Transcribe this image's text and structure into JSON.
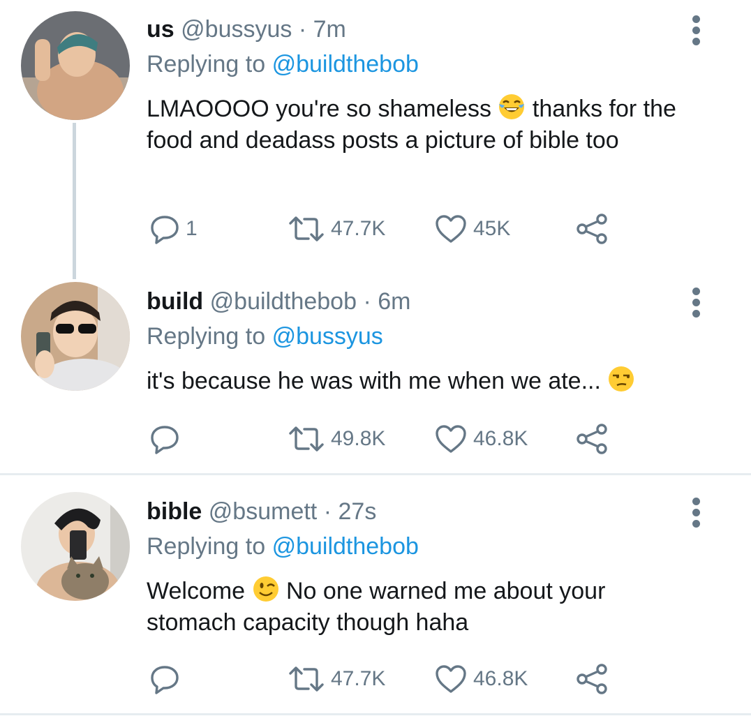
{
  "tweets": [
    {
      "name": "us",
      "handle": "@bussyus",
      "dot": "·",
      "time": "7m",
      "replying_prefix": "Replying to",
      "replying_to": "@buildthebob",
      "text_before": "LMAOOOO you're so shameless",
      "emoji": "face-with-tears-of-joy",
      "text_after": "thanks for the food and deadass posts a picture of bible too",
      "replies": "1",
      "retweets": "47.7K",
      "likes": "45K"
    },
    {
      "name": "build",
      "handle": "@buildthebob",
      "dot": "·",
      "time": "6m",
      "replying_prefix": "Replying to",
      "replying_to": "@bussyus",
      "text_before": "it's because he was with me when we ate...",
      "emoji": "unamused-face",
      "text_after": "",
      "replies": "",
      "retweets": "49.8K",
      "likes": "46.8K"
    },
    {
      "name": "bible",
      "handle": "@bsumett",
      "dot": "·",
      "time": "27s",
      "replying_prefix": "Replying to",
      "replying_to": "@buildthebob",
      "text_before": "Welcome",
      "emoji": "winking-face",
      "text_after": "No one warned me about your stomach capacity though haha",
      "replies": "",
      "retweets": "47.7K",
      "likes": "46.8K"
    }
  ],
  "colors": {
    "accent": "#1b95e0",
    "secondary_text": "#657786",
    "thread_line": "#ccd6dd",
    "divider": "#e6ecf0"
  }
}
